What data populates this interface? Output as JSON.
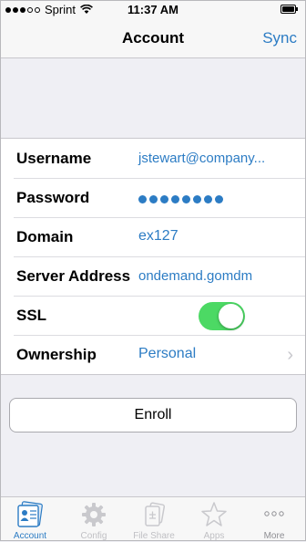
{
  "status_bar": {
    "carrier": "Sprint",
    "time": "11:37 AM"
  },
  "nav": {
    "title": "Account",
    "sync_label": "Sync"
  },
  "form": {
    "username": {
      "label": "Username",
      "value": "jstewart@company..."
    },
    "password": {
      "label": "Password",
      "mask_count": 8
    },
    "domain": {
      "label": "Domain",
      "value": "ex127"
    },
    "server": {
      "label": "Server Address",
      "value": "ondemand.gomdm"
    },
    "ssl": {
      "label": "SSL",
      "enabled": true
    },
    "ownership": {
      "label": "Ownership",
      "value": "Personal"
    }
  },
  "enroll_label": "Enroll",
  "tabs": [
    {
      "label": "Account",
      "icon": "account-icon",
      "active": true
    },
    {
      "label": "Config",
      "icon": "gear-icon",
      "active": false
    },
    {
      "label": "File Share",
      "icon": "file-share-icon",
      "active": false
    },
    {
      "label": "Apps",
      "icon": "star-icon",
      "active": false
    },
    {
      "label": "More",
      "icon": "more-dots-icon",
      "active": false
    }
  ],
  "colors": {
    "accent": "#2c7cc4",
    "toggle_on": "#4cd964",
    "background": "#efeff4"
  }
}
